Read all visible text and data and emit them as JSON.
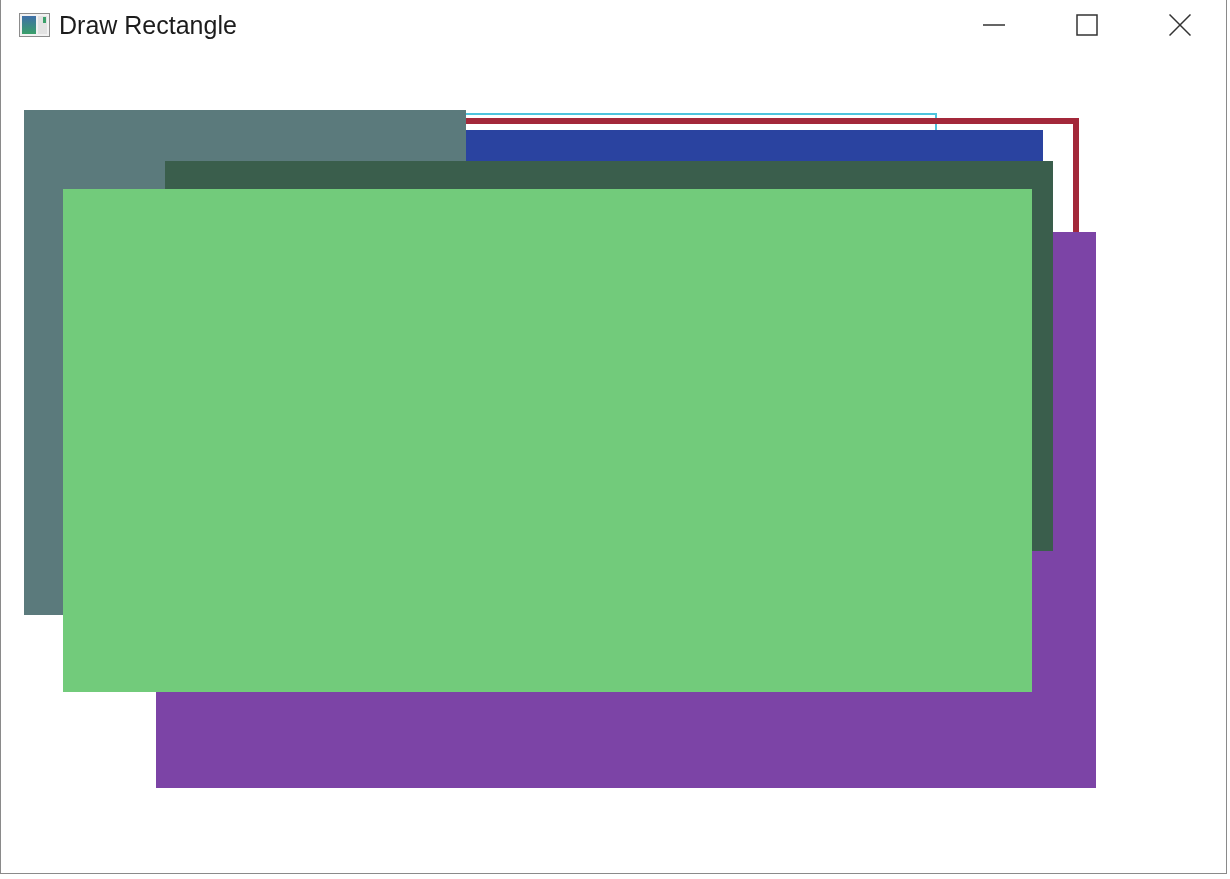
{
  "window": {
    "title": "Draw Rectangle"
  },
  "canvas": {
    "rectangles": [
      {
        "kind": "outline",
        "color": "#4ec3dc"
      },
      {
        "kind": "outline",
        "color": "#a3283a"
      },
      {
        "kind": "filled",
        "color": "#2a43a0"
      },
      {
        "kind": "filled",
        "color": "#5b7a7c"
      },
      {
        "kind": "filled",
        "color": "#7c44a6"
      },
      {
        "kind": "filled",
        "color": "#3a5e4c"
      },
      {
        "kind": "filled",
        "color": "#72cb7b"
      }
    ]
  }
}
